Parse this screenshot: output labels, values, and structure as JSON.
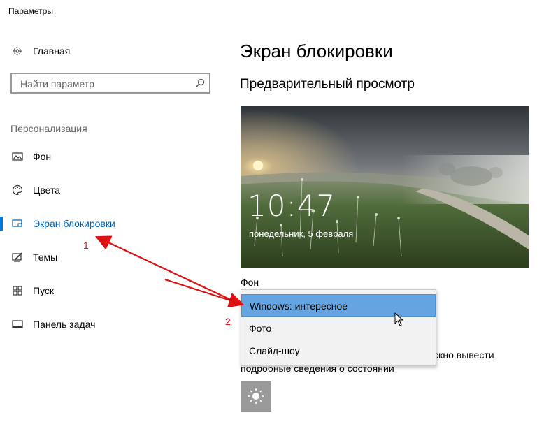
{
  "window": {
    "title": "Параметры"
  },
  "sidebar": {
    "home": {
      "label": "Главная",
      "icon": "gear-icon"
    },
    "search": {
      "placeholder": "Найти параметр",
      "icon": "search-icon"
    },
    "section": "Персонализация",
    "items": [
      {
        "label": "Фон",
        "icon": "picture-icon",
        "active": false
      },
      {
        "label": "Цвета",
        "icon": "palette-icon",
        "active": false
      },
      {
        "label": "Экран блокировки",
        "icon": "lock-screen-icon",
        "active": true
      },
      {
        "label": "Темы",
        "icon": "themes-brush-icon",
        "active": false
      },
      {
        "label": "Пуск",
        "icon": "start-grid-icon",
        "active": false
      },
      {
        "label": "Панель задач",
        "icon": "taskbar-icon",
        "active": false
      }
    ]
  },
  "main": {
    "title": "Экран блокировки",
    "preview_heading": "Предварительный просмотр",
    "preview": {
      "time": "10:47",
      "date": "понедельник, 5 февраля"
    },
    "background": {
      "label": "Фон",
      "options": [
        "Windows: интересное",
        "Фото",
        "Слайд-шоу"
      ],
      "selected": "Windows: интересное"
    },
    "detail_text_end": "жно вывести",
    "detail_text_line2": "подробные сведения о состоянии",
    "app_tile_icon": "sun-brightness-icon"
  },
  "annotations": {
    "label1": "1",
    "label2": "2",
    "color": "#dd1111"
  },
  "accent_color": "#0078d7"
}
